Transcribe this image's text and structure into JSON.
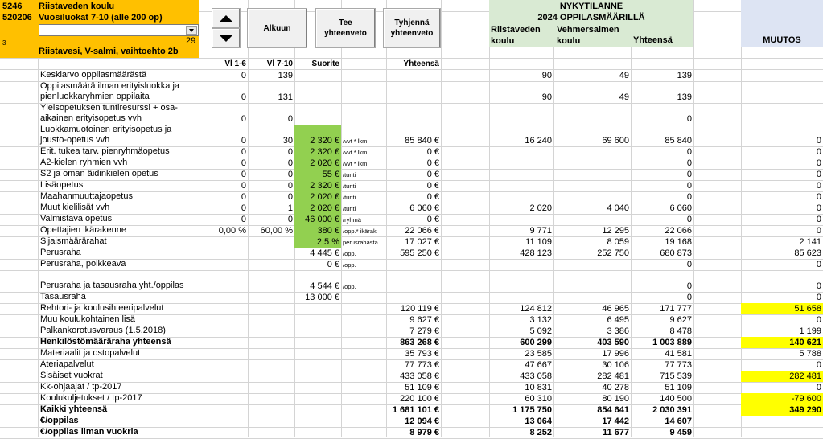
{
  "header": {
    "code1": "5246",
    "code2": "520206",
    "school": "Riistaveden koulu",
    "grades": "Vuosiluokat 7-10 (alle 200 op)",
    "small_num": "3",
    "count": "29",
    "option": "Riistavesi, V-salmi, vaihtoehto 2b",
    "dropdown_value": ""
  },
  "buttons": {
    "top": "Alkuun",
    "summary": "Tee yhteenveto",
    "clear": "Tyhjennä yhteenveto"
  },
  "current": {
    "title1": "NYKYTILANNE",
    "title2": "2024 OPPILASMÄÄRILLÄ",
    "col1": "Riistaveden koulu",
    "col2": "Vehmersalmen koulu",
    "col3": "Yhteensä",
    "change": "MUUTOS"
  },
  "columns": {
    "vl16": "Vl 1-6",
    "vl710": "Vl 7-10",
    "suorite": "Suorite",
    "yhteensa": "Yhteensä"
  },
  "rows": [
    {
      "label": "Keskiarvo oppilasmäärästä",
      "a": "0",
      "b": "139",
      "s": "",
      "u": "",
      "y": "",
      "c1": "90",
      "c2": "49",
      "c3": "139",
      "m": "",
      "green": false,
      "yellow": false,
      "bold": false,
      "h": 14
    },
    {
      "label": "Oppilasmäärä ilman erityisluokka ja pienluokkaryhmien oppilaita",
      "a": "0",
      "b": "131",
      "s": "",
      "u": "",
      "y": "",
      "c1": "90",
      "c2": "49",
      "c3": "139",
      "m": "",
      "green": false,
      "yellow": false,
      "bold": false,
      "h": 27
    },
    {
      "label": "Yleisopetuksen tuntiresurssi + osa-aikainen erityisopetus vvh",
      "a": "0",
      "b": "0",
      "s": "",
      "u": "",
      "y": "",
      "c1": "",
      "c2": "",
      "c3": "0",
      "m": "",
      "green": false,
      "yellow": false,
      "bold": false,
      "h": 27
    },
    {
      "label": "Luokkamuotoinen erityisopetus ja jousto-opetus vvh",
      "a": "0",
      "b": "30",
      "s": "2 320 €",
      "u": "/vvt * lkm",
      "y": "85 840 €",
      "c1": "16 240",
      "c2": "69 600",
      "c3": "85 840",
      "m": "0",
      "green": true,
      "yellow": false,
      "bold": false,
      "h": 27
    },
    {
      "label": "Erit. tukea tarv. pienryhmäopetus",
      "a": "0",
      "b": "0",
      "s": "2 320 €",
      "u": "/vvt * lkm",
      "y": "0 €",
      "c1": "",
      "c2": "",
      "c3": "0",
      "m": "0",
      "green": true,
      "yellow": false,
      "bold": false,
      "h": 14
    },
    {
      "label": "A2-kielen ryhmien vvh",
      "a": "0",
      "b": "0",
      "s": "2 020 €",
      "u": "/vvt * lkm",
      "y": "0 €",
      "c1": "",
      "c2": "",
      "c3": "0",
      "m": "0",
      "green": true,
      "yellow": false,
      "bold": false,
      "h": 14
    },
    {
      "label": "S2 ja oman äidinkielen opetus",
      "a": "0",
      "b": "0",
      "s": "55 €",
      "u": "/tunti",
      "y": "0 €",
      "c1": "",
      "c2": "",
      "c3": "0",
      "m": "0",
      "green": true,
      "yellow": false,
      "bold": false,
      "h": 14
    },
    {
      "label": "Lisäopetus",
      "a": "0",
      "b": "0",
      "s": "2 320 €",
      "u": "/tunti",
      "y": "0 €",
      "c1": "",
      "c2": "",
      "c3": "0",
      "m": "0",
      "green": true,
      "yellow": false,
      "bold": false,
      "h": 14
    },
    {
      "label": "Maahanmuuttajaopetus",
      "a": "0",
      "b": "0",
      "s": "2 020 €",
      "u": "/tunti",
      "y": "0 €",
      "c1": "",
      "c2": "",
      "c3": "0",
      "m": "0",
      "green": true,
      "yellow": false,
      "bold": false,
      "h": 14
    },
    {
      "label": "Muut kielilisät vvh",
      "a": "0",
      "b": "1",
      "s": "2 020 €",
      "u": "/tunti",
      "y": "6 060 €",
      "c1": "2 020",
      "c2": "4 040",
      "c3": "6 060",
      "m": "0",
      "green": true,
      "yellow": false,
      "bold": false,
      "h": 14
    },
    {
      "label": "Valmistava opetus",
      "a": "0",
      "b": "0",
      "s": "46 000 €",
      "u": "/ryhmä",
      "y": "0 €",
      "c1": "",
      "c2": "",
      "c3": "0",
      "m": "0",
      "green": true,
      "yellow": false,
      "bold": false,
      "h": 14
    },
    {
      "label": "Opettajien ikärakenne",
      "a": "0,00 %",
      "b": "60,00 %",
      "s": "380 €",
      "u": "/opp.* ikärak",
      "y": "22 066 €",
      "c1": "9 771",
      "c2": "12 295",
      "c3": "22 066",
      "m": "0",
      "green": true,
      "yellow": false,
      "bold": false,
      "h": 14
    },
    {
      "label": "Sijaismäärärahat",
      "a": "",
      "b": "",
      "s": "2,5 %",
      "u": "perusrahasta",
      "y": "17 027 €",
      "c1": "11 109",
      "c2": "8 059",
      "c3": "19 168",
      "m": "2 141",
      "green": true,
      "yellow": false,
      "bold": false,
      "h": 14
    },
    {
      "label": "Perusraha",
      "a": "",
      "b": "",
      "s": "4 445 €",
      "u": "/opp.",
      "y": "595 250 €",
      "c1": "428 123",
      "c2": "252 750",
      "c3": "680 873",
      "m": "85 623",
      "green": false,
      "yellow": false,
      "bold": false,
      "h": 14
    },
    {
      "label": "Perusraha, poikkeava",
      "a": "",
      "b": "",
      "s": "0 €",
      "u": "/opp.",
      "y": "",
      "c1": "",
      "c2": "",
      "c3": "0",
      "m": "0",
      "green": false,
      "yellow": false,
      "bold": false,
      "h": 14
    },
    {
      "label": "Perusraha ja tasausraha yht./oppilas",
      "a": "",
      "b": "",
      "s": "4 544 €",
      "u": "/opp.",
      "y": "",
      "c1": "",
      "c2": "",
      "c3": "0",
      "m": "0",
      "green": false,
      "yellow": false,
      "bold": false,
      "h": 27
    },
    {
      "label": "Tasausraha",
      "a": "",
      "b": "",
      "s": "13 000 €",
      "u": "",
      "y": "",
      "c1": "",
      "c2": "",
      "c3": "0",
      "m": "0",
      "green": false,
      "yellow": false,
      "bold": false,
      "h": 14
    },
    {
      "label": "Rehtori- ja koulusihteeripalvelut",
      "a": "",
      "b": "",
      "s": "",
      "u": "",
      "y": "120 119 €",
      "c1": "124 812",
      "c2": "46 965",
      "c3": "171 777",
      "m": "51 658",
      "green": false,
      "yellow": true,
      "bold": false,
      "h": 14
    },
    {
      "label": "Muu koulukohtainen lisä",
      "a": "",
      "b": "",
      "s": "",
      "u": "",
      "y": "9 627 €",
      "c1": "3 132",
      "c2": "6 495",
      "c3": "9 627",
      "m": "0",
      "green": false,
      "yellow": false,
      "bold": false,
      "h": 14
    },
    {
      "label": "Palkankorotusvaraus (1.5.2018)",
      "a": "",
      "b": "",
      "s": "",
      "u": "",
      "y": "7 279 €",
      "c1": "5 092",
      "c2": "3 386",
      "c3": "8 478",
      "m": "1 199",
      "green": false,
      "yellow": false,
      "bold": false,
      "h": 14
    },
    {
      "label": "Henkilöstömääräraha yhteensä",
      "a": "",
      "b": "",
      "s": "",
      "u": "",
      "y": "863 268 €",
      "c1": "600 299",
      "c2": "403 590",
      "c3": "1 003 889",
      "m": "140 621",
      "green": false,
      "yellow": true,
      "bold": true,
      "h": 14
    },
    {
      "label": "Materiaalit ja ostopalvelut",
      "a": "",
      "b": "",
      "s": "",
      "u": "",
      "y": "35 793 €",
      "c1": "23 585",
      "c2": "17 996",
      "c3": "41 581",
      "m": "5 788",
      "green": false,
      "yellow": false,
      "bold": false,
      "h": 14
    },
    {
      "label": "Ateriapalvelut",
      "a": "",
      "b": "",
      "s": "",
      "u": "",
      "y": "77 773 €",
      "c1": "47 667",
      "c2": "30 106",
      "c3": "77 773",
      "m": "0",
      "green": false,
      "yellow": false,
      "bold": false,
      "h": 14
    },
    {
      "label": "Sisäiset vuokrat",
      "a": "",
      "b": "",
      "s": "",
      "u": "",
      "y": "433 058 €",
      "c1": "433 058",
      "c2": "282 481",
      "c3": "715 539",
      "m": "282 481",
      "green": false,
      "yellow": true,
      "bold": false,
      "h": 14
    },
    {
      "label": "Kk-ohjaajat / tp-2017",
      "a": "",
      "b": "",
      "s": "",
      "u": "",
      "y": "51 109 €",
      "c1": "10 831",
      "c2": "40 278",
      "c3": "51 109",
      "m": "0",
      "green": false,
      "yellow": false,
      "bold": false,
      "h": 14
    },
    {
      "label": "Koulukuljetukset / tp-2017",
      "a": "",
      "b": "",
      "s": "",
      "u": "",
      "y": "220 100 €",
      "c1": "60 310",
      "c2": "80 190",
      "c3": "140 500",
      "m": "-79 600",
      "green": false,
      "yellow": true,
      "bold": false,
      "h": 14
    },
    {
      "label": "Kaikki yhteensä",
      "a": "",
      "b": "",
      "s": "",
      "u": "",
      "y": "1 681 101 €",
      "c1": "1 175 750",
      "c2": "854 641",
      "c3": "2 030 391",
      "m": "349 290",
      "green": false,
      "yellow": true,
      "bold": true,
      "h": 14
    },
    {
      "label": "€/oppilas",
      "a": "",
      "b": "",
      "s": "",
      "u": "",
      "y": "12 094 €",
      "c1": "13 064",
      "c2": "17 442",
      "c3": "14 607",
      "m": "",
      "green": false,
      "yellow": false,
      "bold": true,
      "h": 14
    },
    {
      "label": "€/oppilas ilman vuokria",
      "a": "",
      "b": "",
      "s": "",
      "u": "",
      "y": "8 979 €",
      "c1": "8 252",
      "c2": "11 677",
      "c3": "9 459",
      "m": "",
      "green": false,
      "yellow": false,
      "bold": true,
      "h": 14
    }
  ]
}
